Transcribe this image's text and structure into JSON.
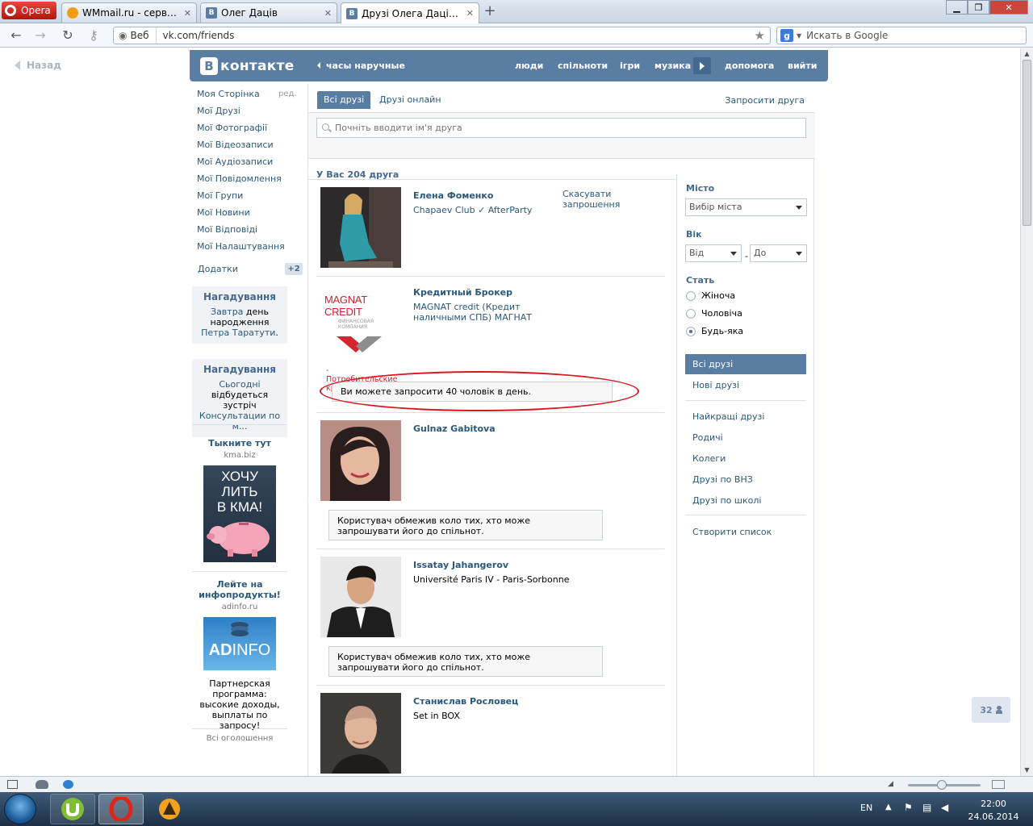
{
  "browser": {
    "menu_label": "Opera",
    "tabs": [
      {
        "label": "WMmail.ru - сервис п...",
        "favicon": "wmmail-icon"
      },
      {
        "label": "Олег Дацiв",
        "favicon": "vk-icon"
      },
      {
        "label": "Друзi Олега Дацiва | 2...",
        "favicon": "vk-icon"
      }
    ],
    "address_prefix": "Веб",
    "url": "vk.com/friends",
    "search_placeholder": "Искать в Google"
  },
  "page": {
    "back_label": "Назад",
    "header": {
      "logo_letter": "В",
      "logo_text": "контакте",
      "status": "часы наручные",
      "nav": [
        "люди",
        "спільноти",
        "ігри",
        "музика",
        "допомога",
        "вийти"
      ]
    },
    "left_menu": {
      "items": [
        "Моя Сторінка",
        "Мої Друзі",
        "Мої Фотографії",
        "Мої Відеозаписи",
        "Мої Аудіозаписи",
        "Мої Повідомлення",
        "Мої Групи",
        "Мої Новини",
        "Мої Відповіді",
        "Мої Налаштування"
      ],
      "edit_label": "ред.",
      "addons_label": "Додатки",
      "addons_count": "+2"
    },
    "reminders": [
      {
        "title": "Нагадування",
        "link1": "Завтра",
        "text1": " день народження ",
        "link2": "Петра Таратути",
        "text2": "."
      },
      {
        "title": "Нагадування",
        "link1": "Сьогодні",
        "text1": " відбудеться зустріч ",
        "link2": "Консультации по м...",
        "text2": ""
      }
    ],
    "ads": [
      {
        "title": "Тыкните тут",
        "domain": "kma.biz",
        "image_text": [
          "ХОЧУ",
          "ЛИТЬ",
          "В КМА!"
        ],
        "description": ""
      },
      {
        "title": "Лейте на инфопродукты!",
        "domain": "adinfo.ru",
        "image_text": [
          "AD",
          "INFO"
        ],
        "description": "Партнерская программа: высокие доходы, выплаты по запросу!"
      }
    ],
    "all_ads_label": "Всі оголошення",
    "content": {
      "tabs": [
        "Всі друзі",
        "Друзі онлайн"
      ],
      "invite_label": "Запросити друга",
      "search_placeholder": "Почніть вводити ім'я друга",
      "count_label": "У Вас 204 друга",
      "friends": [
        {
          "name": "Елена Фоменко",
          "info": "Chapaev Club ✓ AfterParty",
          "action": "Скасувати запрошення"
        },
        {
          "name": "Кредитный Брокер",
          "info": "MAGNAT credit (Кредит наличными СПБ) МАГНАТ",
          "logo_title": "MAGNAT CREDIT",
          "logo_sub": "ФИНАНСОВАЯ КОМПАНИЯ",
          "logo_caption": "- Потребительские кредиты",
          "notice": "Ви можете запросити 40 чоловік в день."
        },
        {
          "name": "Gulnaz Gabitova",
          "info": "",
          "notice": "Користувач обмежив коло тих, хто може запрошувати його до спільнот."
        },
        {
          "name": "Issatay Jahangerov",
          "info": "Université Paris IV - Paris-Sorbonne",
          "notice": "Користувач обмежив коло тих, хто може запрошувати його до спільнот."
        },
        {
          "name": "Станислав Рословец",
          "info": "Set in BOX"
        }
      ]
    },
    "filters": {
      "city_label": "Місто",
      "city_select": "Вибір міста",
      "age_label": "Вік",
      "age_from": "Від",
      "age_to": "До",
      "age_dash": "-",
      "sex_label": "Стать",
      "sex_options": [
        "Жіноча",
        "Чоловіча",
        "Будь-яка"
      ],
      "sex_selected": 2,
      "lists_primary": [
        "Всі друзі",
        "Нові друзі"
      ],
      "lists_secondary": [
        "Найкращі друзі",
        "Родичі",
        "Колеги",
        "Друзі по ВНЗ",
        "Друзі по школі"
      ],
      "create_list": "Створити список"
    },
    "corner_badge": "32"
  },
  "taskbar": {
    "lang": "EN",
    "time": "22:00",
    "date": "24.06.2014"
  },
  "colors": {
    "vk_blue": "#597da3",
    "vk_link": "#2b587a",
    "annotation_red": "#d8161b"
  }
}
